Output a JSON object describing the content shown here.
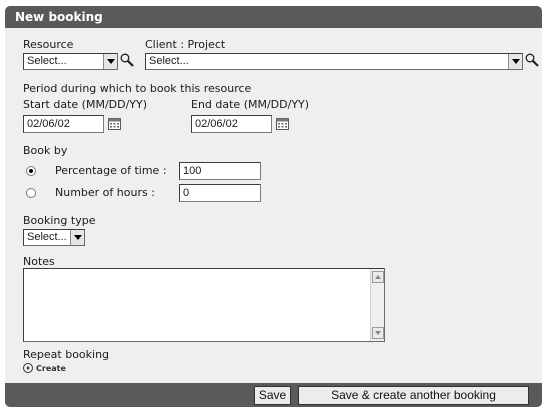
{
  "dialog": {
    "title": "New booking"
  },
  "resource": {
    "label": "Resource",
    "value": "Select..."
  },
  "client_project": {
    "label": "Client : Project",
    "value": "Select..."
  },
  "period": {
    "heading": "Period during which to book this resource",
    "start_label": "Start date (MM/DD/YY)",
    "start_value": "02/06/02",
    "end_label": "End date (MM/DD/YY)",
    "end_value": "02/06/02"
  },
  "book_by": {
    "heading": "Book by",
    "percentage_label": "Percentage of time :",
    "percentage_value": "100",
    "percentage_selected": true,
    "hours_label": "Number of hours :",
    "hours_value": "0"
  },
  "booking_type": {
    "label": "Booking type",
    "value": "Select..."
  },
  "notes": {
    "label": "Notes",
    "value": ""
  },
  "repeat": {
    "label": "Repeat booking",
    "create_label": "Create"
  },
  "footer": {
    "save_label": "Save",
    "save_create_label": "Save & create another booking"
  },
  "icons": {
    "lookup": "magnifier-icon",
    "calendar": "calendar-icon"
  },
  "colors": {
    "titlebar": "#5a5a5a",
    "panel": "#efefef",
    "footer": "#5a5a5a"
  }
}
